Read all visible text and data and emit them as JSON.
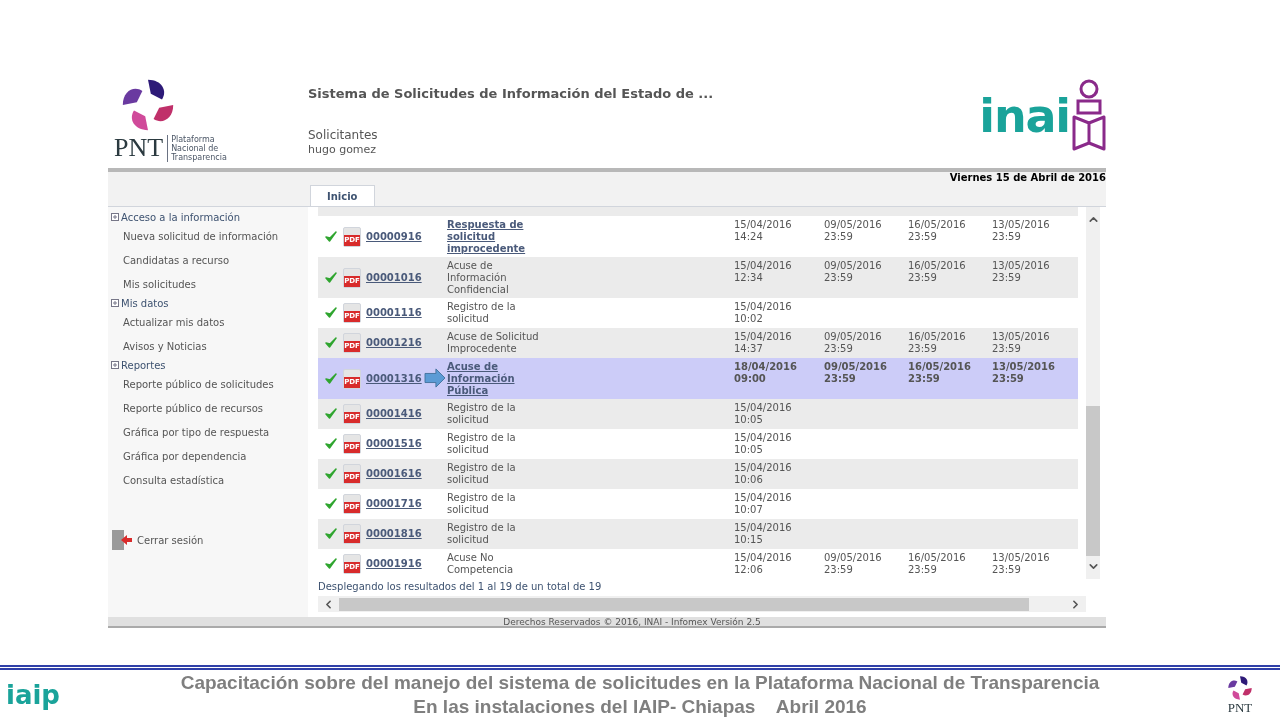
{
  "header": {
    "logo": {
      "name": "PNT",
      "tagline": [
        "Plataforma",
        "Nacional de",
        "Transparencia"
      ]
    },
    "title": "Sistema de Solicitudes de Información del Estado de ...",
    "role": "Solicitantes",
    "user": "hugo gomez",
    "brand": "inai"
  },
  "date_bar": "Viernes 15 de Abril de 2016",
  "tabs": [
    {
      "label": "Inicio",
      "selected": true
    }
  ],
  "sidebar": {
    "sections": [
      {
        "title": "Acceso a la información",
        "items": [
          "Nueva solicitud de información",
          "Candidatas a recurso",
          "Mis solicitudes"
        ]
      },
      {
        "title": "Mis datos",
        "items": [
          "Actualizar mis datos",
          "Avisos y Noticias"
        ]
      },
      {
        "title": "Reportes",
        "items": [
          "Reporte público de solicitudes",
          "Reporte público de recursos",
          "Gráfica por tipo de respuesta",
          "Gráfica por dependencia",
          "Consulta estadística"
        ]
      }
    ],
    "logout": "Cerrar sesión"
  },
  "table": {
    "rows": [
      {
        "pdf": "PDF",
        "folio": "00000916",
        "description": [
          "Respuesta de",
          "solicitud",
          "improcedente"
        ],
        "linked": true,
        "selected": false,
        "pointer": false,
        "dates": [
          [
            "15/04/2016",
            "14:24"
          ],
          [
            "09/05/2016",
            "23:59"
          ],
          [
            "16/05/2016",
            "23:59"
          ],
          [
            "13/05/2016",
            "23:59"
          ]
        ]
      },
      {
        "pdf": "PDF",
        "folio": "00001016",
        "description": [
          "Acuse de",
          "Información",
          "Confidencial"
        ],
        "linked": false,
        "selected": false,
        "pointer": false,
        "dates": [
          [
            "15/04/2016",
            "12:34"
          ],
          [
            "09/05/2016",
            "23:59"
          ],
          [
            "16/05/2016",
            "23:59"
          ],
          [
            "13/05/2016",
            "23:59"
          ]
        ]
      },
      {
        "pdf": "PDF",
        "folio": "00001116",
        "description": [
          "Registro de la",
          "solicitud"
        ],
        "linked": false,
        "selected": false,
        "pointer": false,
        "dates": [
          [
            "15/04/2016",
            "10:02"
          ]
        ]
      },
      {
        "pdf": "PDF",
        "folio": "00001216",
        "description": [
          "Acuse de Solicitud",
          "Improcedente"
        ],
        "linked": false,
        "selected": false,
        "pointer": false,
        "dates": [
          [
            "15/04/2016",
            "14:37"
          ],
          [
            "09/05/2016",
            "23:59"
          ],
          [
            "16/05/2016",
            "23:59"
          ],
          [
            "13/05/2016",
            "23:59"
          ]
        ]
      },
      {
        "pdf": "PDF",
        "folio": "00001316",
        "description": [
          "Acuse de",
          "Información",
          "Pública"
        ],
        "linked": true,
        "selected": true,
        "pointer": true,
        "dates": [
          [
            "18/04/2016",
            "09:00"
          ],
          [
            "09/05/2016",
            "23:59"
          ],
          [
            "16/05/2016",
            "23:59"
          ],
          [
            "13/05/2016",
            "23:59"
          ]
        ]
      },
      {
        "pdf": "PDF",
        "folio": "00001416",
        "description": [
          "Registro de la",
          "solicitud"
        ],
        "linked": false,
        "selected": false,
        "pointer": false,
        "dates": [
          [
            "15/04/2016",
            "10:05"
          ]
        ]
      },
      {
        "pdf": "PDF",
        "folio": "00001516",
        "description": [
          "Registro de la",
          "solicitud"
        ],
        "linked": false,
        "selected": false,
        "pointer": false,
        "dates": [
          [
            "15/04/2016",
            "10:05"
          ]
        ]
      },
      {
        "pdf": "PDF",
        "folio": "00001616",
        "description": [
          "Registro de la",
          "solicitud"
        ],
        "linked": false,
        "selected": false,
        "pointer": false,
        "dates": [
          [
            "15/04/2016",
            "10:06"
          ]
        ]
      },
      {
        "pdf": "PDF",
        "folio": "00001716",
        "description": [
          "Registro de la",
          "solicitud"
        ],
        "linked": false,
        "selected": false,
        "pointer": false,
        "dates": [
          [
            "15/04/2016",
            "10:07"
          ]
        ]
      },
      {
        "pdf": "PDF",
        "folio": "00001816",
        "description": [
          "Registro de la",
          "solicitud"
        ],
        "linked": false,
        "selected": false,
        "pointer": false,
        "dates": [
          [
            "15/04/2016",
            "10:15"
          ]
        ]
      },
      {
        "pdf": "PDF",
        "folio": "00001916",
        "description": [
          "Acuse No",
          "Competencia"
        ],
        "linked": false,
        "selected": false,
        "pointer": false,
        "dates": [
          [
            "15/04/2016",
            "12:06"
          ],
          [
            "09/05/2016",
            "23:59"
          ],
          [
            "16/05/2016",
            "23:59"
          ],
          [
            "13/05/2016",
            "23:59"
          ]
        ]
      }
    ],
    "summary": "Desplegando los resultados del 1 al 19 de un total de 19"
  },
  "app_footer": "Derechos Reservados © 2016, INAI - Infomex Versión 2.5",
  "slide_footer": {
    "lines": [
      "Capacitación sobre del manejo del sistema de solicitudes en la Plataforma Nacional de Transparencia",
      "En las instalaciones del IAIP- Chiapas    Abril 2016"
    ],
    "left_logo": "iaip",
    "right_logo": "PNT"
  }
}
